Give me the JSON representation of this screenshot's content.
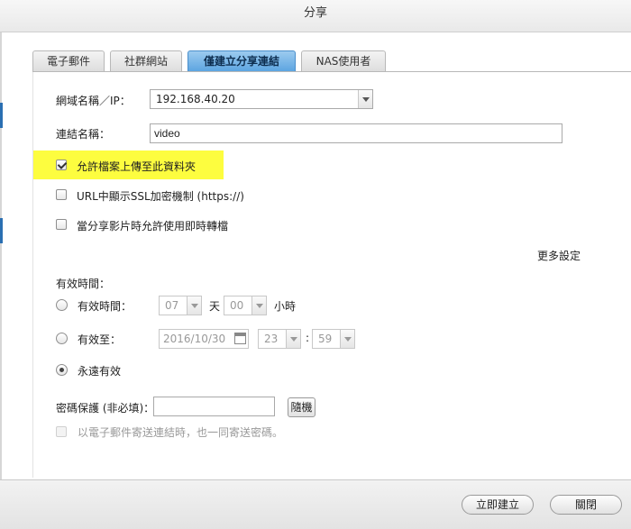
{
  "title": "分享",
  "tabs": [
    "電子郵件",
    "社群網站",
    "僅建立分享連結",
    "NAS使用者"
  ],
  "form": {
    "domain_label": "網域名稱／IP：",
    "domain_value": "192.168.40.20",
    "link_name_label": "連結名稱：",
    "link_name_value": "video",
    "allow_upload_label": "允許檔案上傳至此資料夾",
    "allow_upload_checked": true,
    "ssl_label": "URL中顯示SSL加密機制 (https://)",
    "ssl_checked": false,
    "transcode_label": "當分享影片時允許使用即時轉檔",
    "transcode_checked": false,
    "more_settings": "更多設定",
    "validity_heading": "有效時間：",
    "validity_duration_label": "有效時間：",
    "days_value": "07",
    "days_unit": "天",
    "hours_value": "00",
    "hours_unit": "小時",
    "valid_until_label": "有效至：",
    "date_value": "2016/10/30",
    "until_hour": "23",
    "time_sep": ":",
    "until_minute": "59",
    "forever_label": "永遠有效",
    "validity_selected": "forever",
    "password_label": "密碼保護 (非必填)：",
    "password_value": "",
    "random_button": "隨機",
    "send_password_label": "以電子郵件寄送連結時，也一同寄送密碼。"
  },
  "footer": {
    "create_button": "立即建立",
    "close_button": "關閉"
  },
  "colors": {
    "highlight": "#fdfd3f",
    "active_tab": "#5aa3e0"
  }
}
